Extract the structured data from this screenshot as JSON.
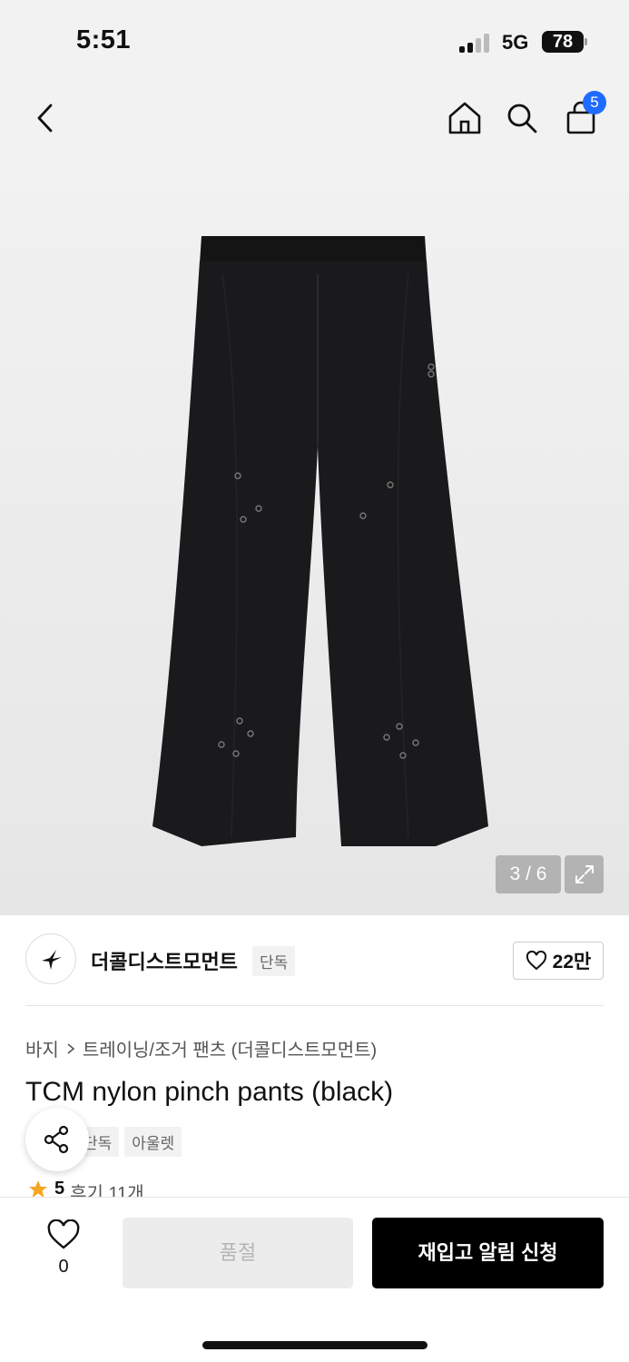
{
  "status_bar": {
    "time": "5:51",
    "network": "5G",
    "battery": "78"
  },
  "nav": {
    "back_icon": "chevron-left-icon",
    "home_icon": "home-icon",
    "search_icon": "search-icon",
    "cart_icon": "shopping-bag-icon",
    "cart_count": "5",
    "badge_color": "#1e6bff"
  },
  "gallery": {
    "page_indicator": "3 / 6",
    "expand_icon": "expand-icon"
  },
  "brand": {
    "name": "더콜디스트모먼트",
    "tag": "단독",
    "like_count": "22만"
  },
  "product": {
    "breadcrumb": [
      "바지",
      "트레이닝/조거 팬츠 (더콜디스트모먼트)"
    ],
    "title": "TCM nylon pinch pants (black)",
    "tags": [
      "단독",
      "아울렛"
    ],
    "rating": "5",
    "reviews": "후기 11개"
  },
  "bottom": {
    "wish_count": "0",
    "soldout_label": "품절",
    "restock_label": "재입고 알림 신청"
  },
  "colors": {
    "accent_star": "#f5a623",
    "primary_button": "#000000",
    "disabled_button": "#ececec"
  }
}
